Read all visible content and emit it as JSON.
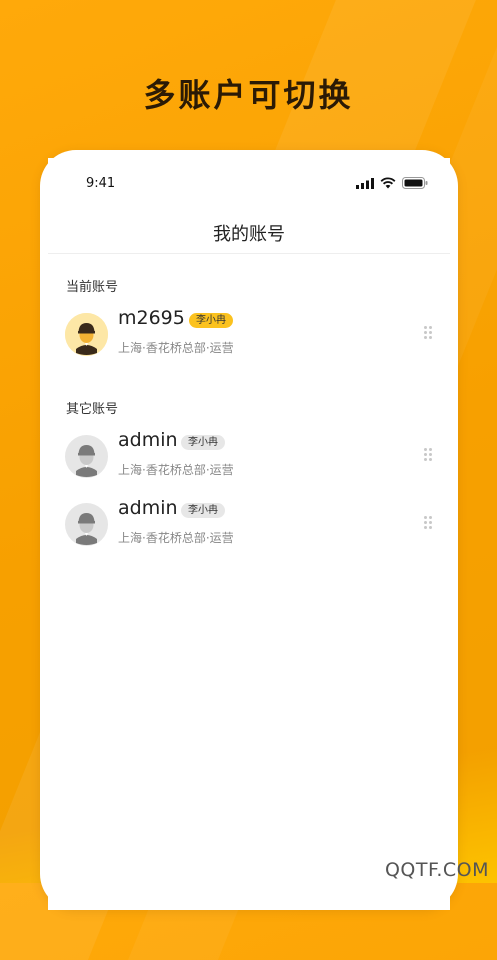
{
  "hero": {
    "title": "多账户可切换"
  },
  "status_bar": {
    "time": "9:41"
  },
  "nav": {
    "title": "我的账号"
  },
  "current_section": {
    "label": "当前账号",
    "account": {
      "name": "m2695",
      "badge": "李小冉",
      "location": "上海·香花桥总部·运营"
    }
  },
  "other_section": {
    "label": "其它账号",
    "accounts": [
      {
        "name": "admin",
        "badge": "李小冉",
        "location": "上海·香花桥总部·运营"
      },
      {
        "name": "admin",
        "badge": "李小冉",
        "location": "上海·香花桥总部·运营"
      }
    ]
  },
  "watermark": "QQTF.COM",
  "colors": {
    "accent": "#fbc21f",
    "background": "#f7a000",
    "avatar_current_bg": "#fde7a6",
    "avatar_other_bg": "#e6e6e6"
  }
}
